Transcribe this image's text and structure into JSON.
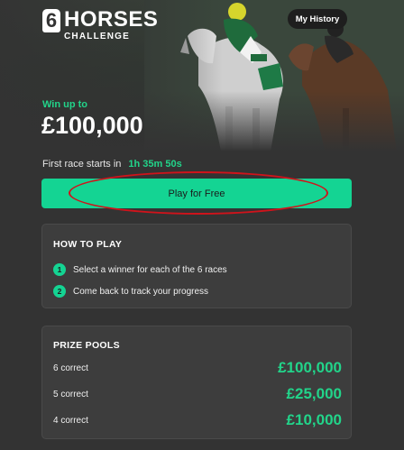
{
  "header": {
    "logo_number": "6",
    "logo_title": "HORSES",
    "logo_subtitle": "CHALLENGE",
    "history_button": "My History"
  },
  "hero": {
    "win_label": "Win up to",
    "win_amount": "£100,000"
  },
  "race": {
    "label": "First race starts in",
    "countdown": "1h 35m 50s"
  },
  "play_button": "Play for Free",
  "how_to_play": {
    "title": "HOW TO PLAY",
    "steps": [
      {
        "num": "1",
        "text": "Select a winner for each of the 6 races"
      },
      {
        "num": "2",
        "text": "Come back to track your progress"
      }
    ]
  },
  "prize_pools": {
    "title": "PRIZE POOLS",
    "rows": [
      {
        "label": "6 correct",
        "amount": "£100,000"
      },
      {
        "label": "5 correct",
        "amount": "£25,000"
      },
      {
        "label": "4 correct",
        "amount": "£10,000"
      }
    ]
  },
  "colors": {
    "accent": "#14d493",
    "background": "#333333",
    "annotation_ring": "#d0131b"
  }
}
